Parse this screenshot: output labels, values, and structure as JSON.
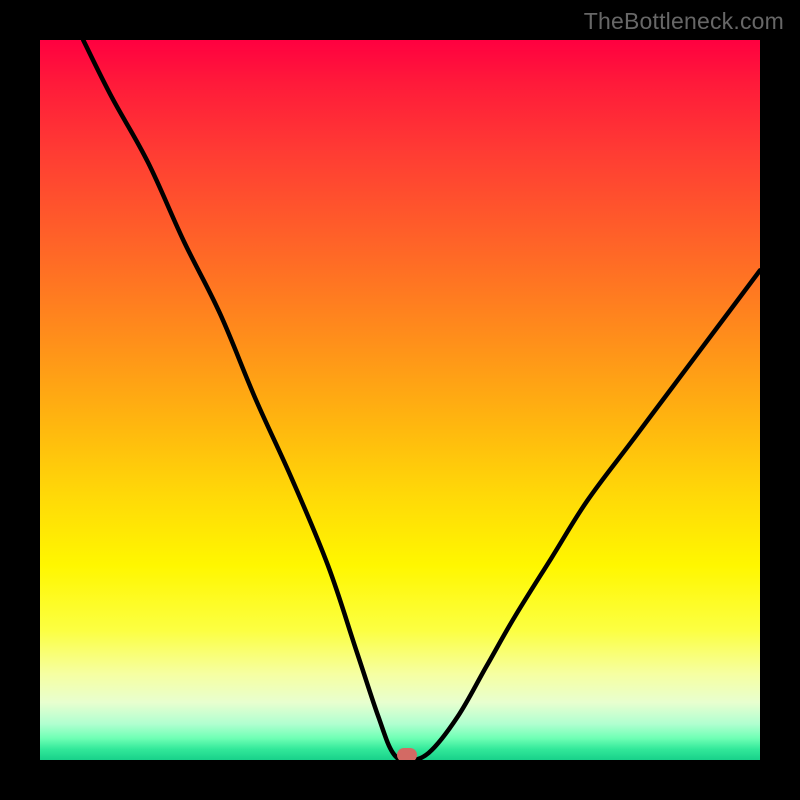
{
  "watermark": "TheBottleneck.com",
  "colors": {
    "frame_bg": "#000000",
    "curve_stroke": "#000000",
    "marker_fill": "#d36a64"
  },
  "chart_data": {
    "type": "line",
    "title": "",
    "xlabel": "",
    "ylabel": "",
    "xlim": [
      0,
      100
    ],
    "ylim": [
      0,
      100
    ],
    "grid": false,
    "series": [
      {
        "name": "bottleneck-curve",
        "x": [
          6,
          10,
          15,
          20,
          25,
          30,
          35,
          40,
          44,
          47,
          49,
          51,
          54,
          58,
          62,
          66,
          71,
          76,
          82,
          88,
          94,
          100
        ],
        "y": [
          100,
          92,
          83,
          72,
          62,
          50,
          39,
          27,
          15,
          6,
          1,
          0,
          1,
          6,
          13,
          20,
          28,
          36,
          44,
          52,
          60,
          68
        ]
      }
    ],
    "annotations": [
      {
        "name": "minimum-marker",
        "x": 51,
        "y": 0
      }
    ],
    "background_gradient_stops": [
      {
        "pos": 0,
        "color": "#ff0040"
      },
      {
        "pos": 0.3,
        "color": "#ff6926"
      },
      {
        "pos": 0.63,
        "color": "#ffd808"
      },
      {
        "pos": 0.82,
        "color": "#fcff42"
      },
      {
        "pos": 1.0,
        "color": "#18d18a"
      }
    ]
  }
}
